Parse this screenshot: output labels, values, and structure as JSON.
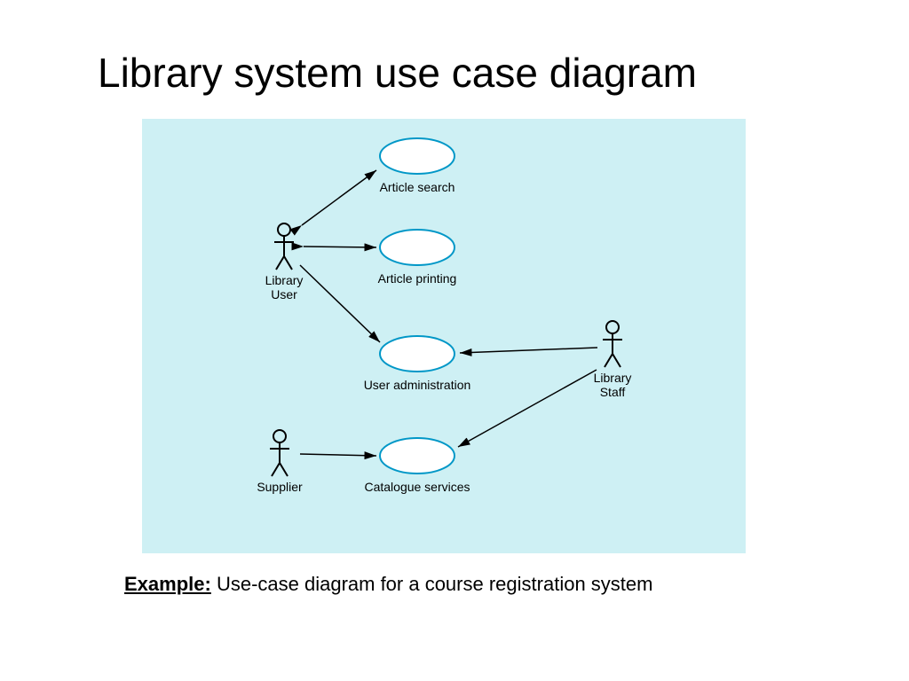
{
  "title": "Library system use case diagram",
  "caption_label": "Example:",
  "caption_text": "  Use-case diagram for a course registration system",
  "usecases": {
    "article_search": "Article search",
    "article_printing": "Article printing",
    "user_administration": "User administration",
    "catalogue_services": "Catalogue services"
  },
  "actors": {
    "library_user_l1": "Library",
    "library_user_l2": "User",
    "library_staff_l1": "Library",
    "library_staff_l2": "Staff",
    "supplier": "Supplier"
  }
}
